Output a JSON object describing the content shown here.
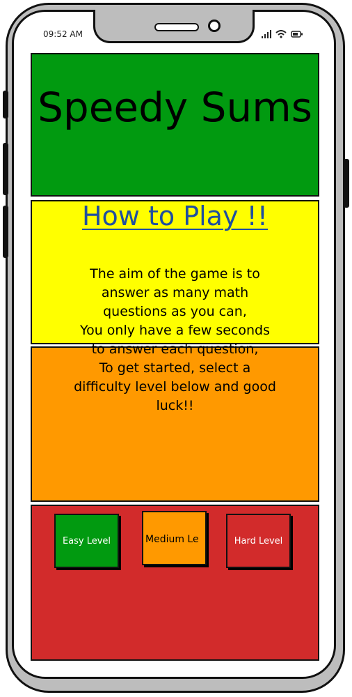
{
  "status_bar": {
    "time": "09:52 AM",
    "icons": [
      "signal-icon",
      "wifi-icon",
      "battery-icon"
    ]
  },
  "app": {
    "title": "Speedy Sums"
  },
  "how_to_play": {
    "title": "How to Play !!",
    "lines": [
      "The aim of the game is to",
      "answer as many math",
      "questions as you can,",
      "You only have a few seconds",
      "to answer each question,",
      "To get started, select a",
      "difficulty level below and good",
      "luck!!"
    ]
  },
  "levels": {
    "easy_label": "Easy Level",
    "medium_label": "Medium Le",
    "hard_label": "Hard Level"
  },
  "colors": {
    "title_panel": "#019a10",
    "info_panel": "#ffff00",
    "orange_panel": "#ff9900",
    "levels_panel": "#d22b2b",
    "howto_title": "#1f4fa0"
  }
}
